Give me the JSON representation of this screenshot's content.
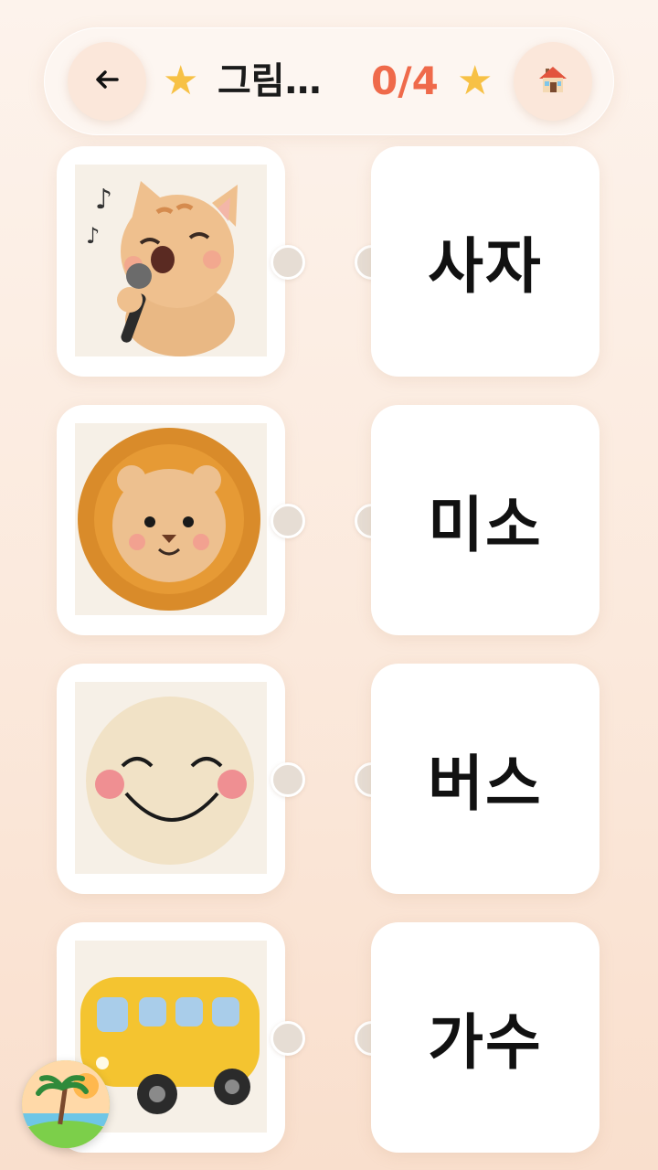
{
  "header": {
    "title": "그림…",
    "score": "0/4",
    "back_icon": "arrow-left-icon",
    "home_icon": "house-icon",
    "star_color": "#f7c145",
    "score_color": "#ef6a4b"
  },
  "pictures": [
    {
      "subject": "singing-kitten-icon"
    },
    {
      "subject": "lion-icon"
    },
    {
      "subject": "smiley-face-icon"
    },
    {
      "subject": "bus-icon"
    }
  ],
  "words": [
    {
      "label": "사자"
    },
    {
      "label": "미소"
    },
    {
      "label": "버스"
    },
    {
      "label": "가수"
    }
  ],
  "badge": {
    "icon": "beach-palm-logo"
  }
}
